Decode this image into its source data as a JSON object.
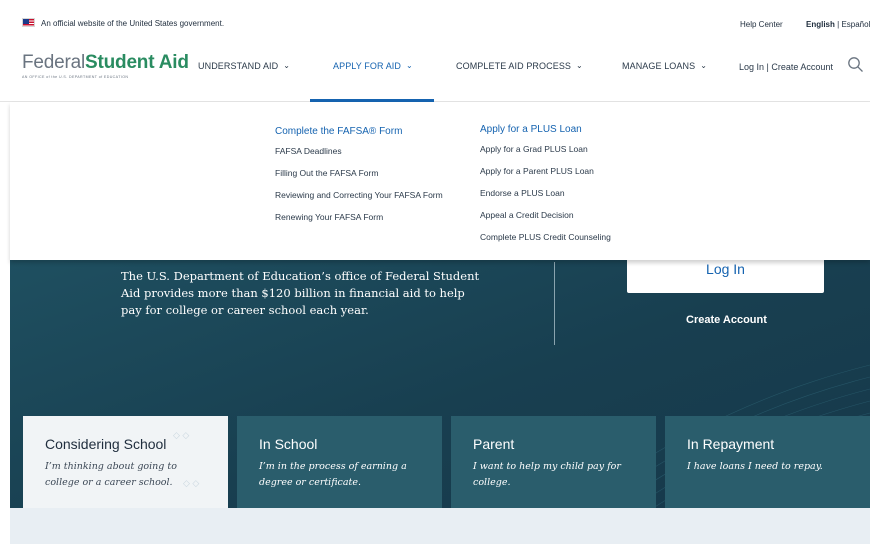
{
  "gov_banner": {
    "official_text": "An official website of the United States government.",
    "help_center": "Help Center",
    "english": "English",
    "separator": "|",
    "espanol": "Español"
  },
  "header": {
    "logo_federal": "Federal",
    "logo_student_aid": "Student Aid",
    "logo_tagline": "AN OFFICE of the U.S. DEPARTMENT of EDUCATION",
    "nav": [
      {
        "label": "UNDERSTAND AID"
      },
      {
        "label": "APPLY FOR AID"
      },
      {
        "label": "COMPLETE AID PROCESS"
      },
      {
        "label": "MANAGE LOANS"
      }
    ],
    "login": "Log In",
    "divider": "|",
    "create_account": "Create Account",
    "active_color": "#1563b0"
  },
  "dropdown": {
    "fafsa": {
      "heading": "Complete the FAFSA® Form",
      "links": [
        "FAFSA Deadlines",
        "Filling Out the FAFSA Form",
        "Reviewing and Correcting Your FAFSA Form",
        "Renewing Your FAFSA Form"
      ]
    },
    "plus": {
      "heading": "Apply for a PLUS Loan",
      "links": [
        "Apply for a Grad PLUS Loan",
        "Apply for a Parent PLUS Loan",
        "Endorse a PLUS Loan",
        "Appeal a Credit Decision",
        "Complete PLUS Credit Counseling"
      ]
    }
  },
  "hero": {
    "text": "The U.S. Department of Education’s office of Federal Student Aid provides more than $120 billion in financial aid to help pay for college or career school each year.",
    "login_button": "Log In",
    "create_account": "Create Account"
  },
  "cards": [
    {
      "title": "Considering School",
      "desc": "I’m thinking about going to college or a career school."
    },
    {
      "title": "In School",
      "desc": "I’m in the process of earning a degree or certificate."
    },
    {
      "title": "Parent",
      "desc": "I want to help my child pay for college."
    },
    {
      "title": "In Repayment",
      "desc": "I have loans I need to repay."
    }
  ],
  "icons": {
    "search": "search-icon",
    "chevron": "chevron-down-icon",
    "flag": "us-flag-icon"
  }
}
